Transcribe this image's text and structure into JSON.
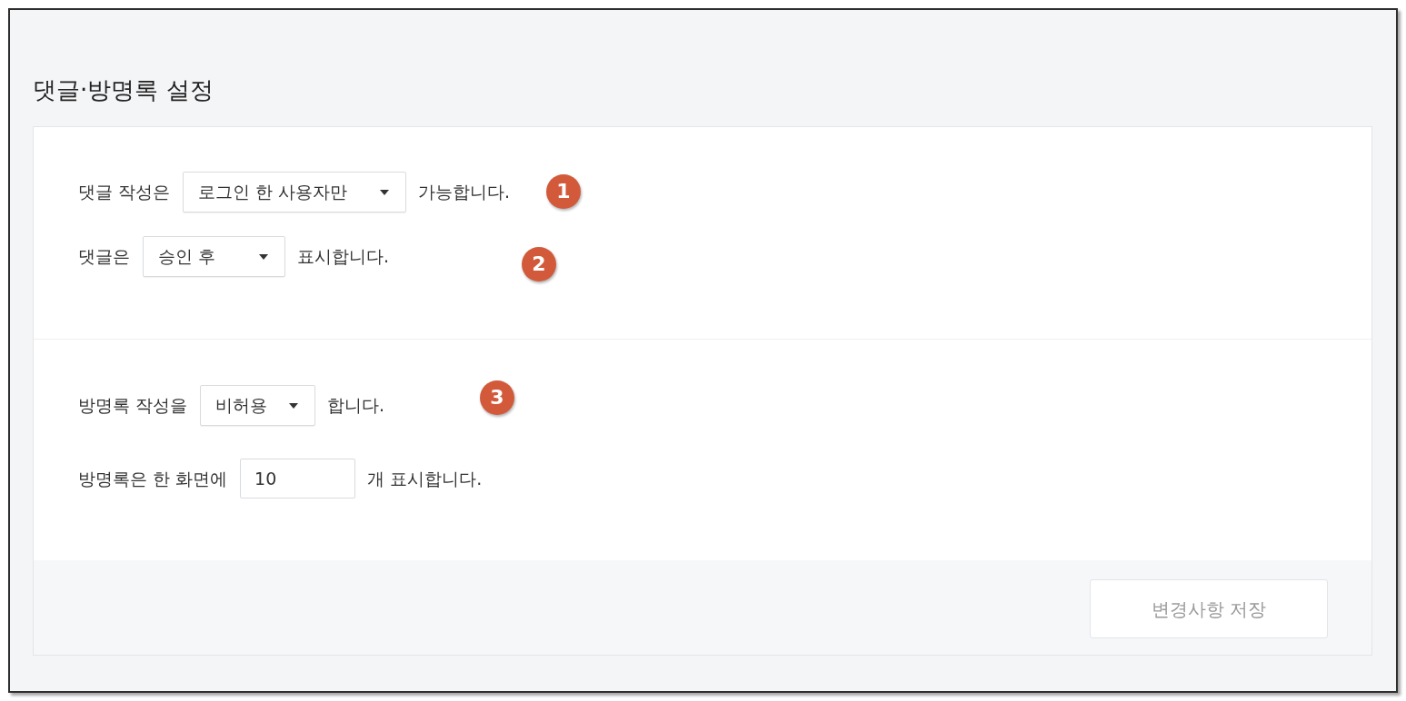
{
  "title": "댓글·방명록 설정",
  "sections": [
    {
      "rows": [
        {
          "kind": "select",
          "label": "댓글 작성은",
          "value": "로그인 한 사용자만",
          "suffix": "가능합니다."
        },
        {
          "kind": "select",
          "label": "댓글은",
          "value": "승인 후",
          "suffix": "표시합니다."
        }
      ]
    },
    {
      "rows": [
        {
          "kind": "select",
          "label": "방명록 작성을",
          "value": "비허용",
          "suffix": "합니다."
        },
        {
          "kind": "number",
          "label": "방명록은 한 화면에",
          "value": "10",
          "suffix": "개 표시합니다."
        }
      ]
    }
  ],
  "annotations": [
    {
      "text": "1"
    },
    {
      "text": "2"
    },
    {
      "text": "3"
    }
  ],
  "save_button": {
    "label": "변경사항 저장",
    "disabled": true
  }
}
